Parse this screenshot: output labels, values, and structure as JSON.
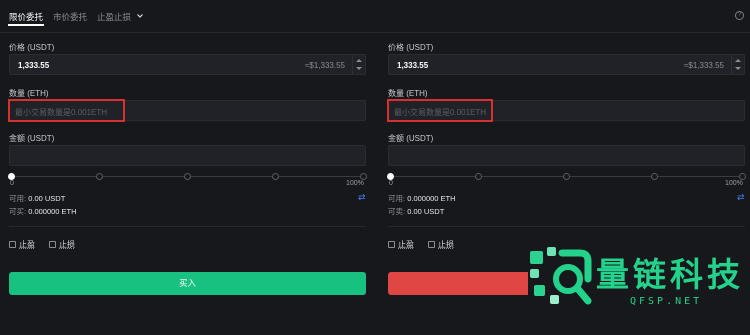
{
  "tabs": {
    "limit": "限价委托",
    "market": "市价委托",
    "tpsl": "止盈止损"
  },
  "buy_panel": {
    "price_label": "价格 (USDT)",
    "price_value": "1,333.55",
    "price_approx": "≈$1,333.55",
    "amount_label": "数量 (ETH)",
    "amount_placeholder": "最小交易数量是0.001ETH",
    "total_label": "金额 (USDT)",
    "slider_min": "0",
    "slider_max": "100%",
    "available_label": "可用:",
    "available_value": "0.00 USDT",
    "can_buy_label": "可买:",
    "can_buy_value": "0.000000 ETH",
    "take_profit": "止盈",
    "stop_loss": "止损",
    "button": "买入"
  },
  "sell_panel": {
    "price_label": "价格 (USDT)",
    "price_value": "1,333.55",
    "price_approx": "≈$1,333.55",
    "amount_label": "数量 (ETH)",
    "amount_placeholder": "最小交易数量是0.001ETH",
    "total_label": "金额 (USDT)",
    "slider_min": "0",
    "slider_max": "100%",
    "available_label": "可用:",
    "available_value": "0.000000 ETH",
    "can_sell_label": "可卖:",
    "can_sell_value": "0.00 USDT",
    "take_profit": "止盈",
    "stop_loss": "止损"
  },
  "watermark": {
    "text": "量链科技",
    "sub": "QFSP.NET"
  },
  "colors": {
    "buy": "#19c180",
    "sell": "#e04643",
    "highlight": "#d5312d",
    "swap": "#3f7ef0"
  }
}
